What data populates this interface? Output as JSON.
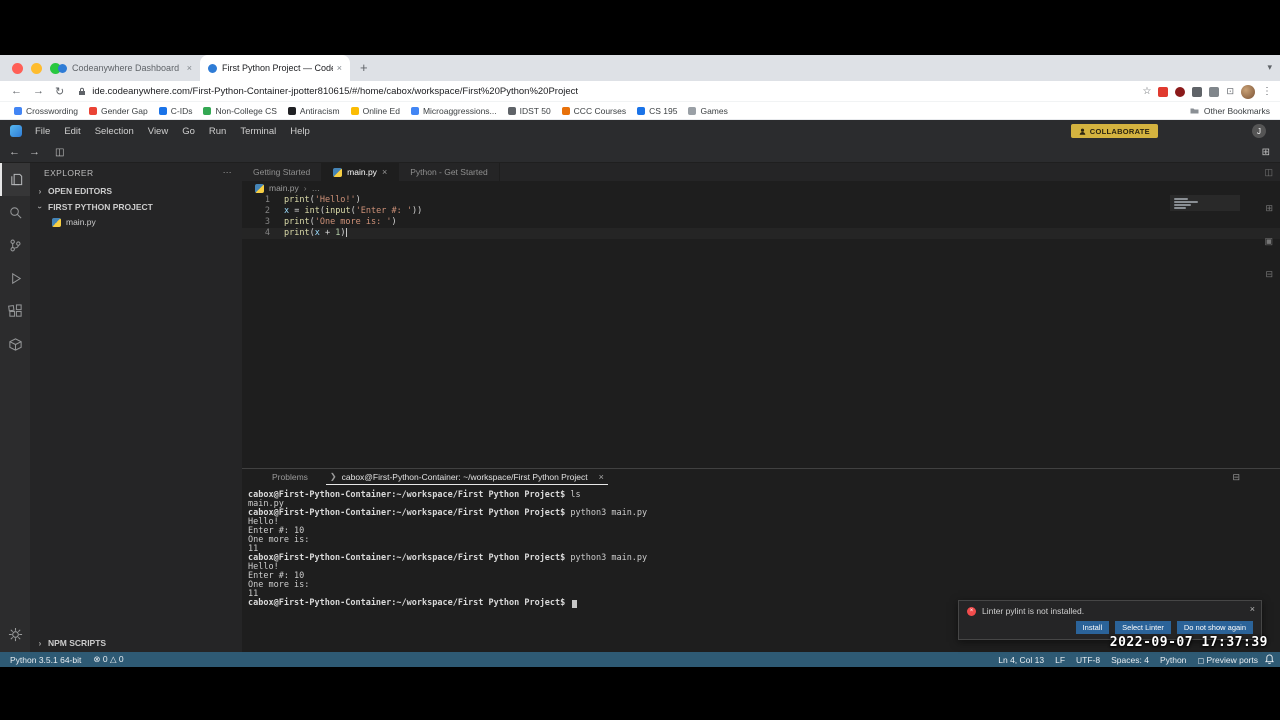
{
  "colors": {
    "statusbar_bg": "#2e5a74",
    "collaborate_bg": "#d4b33f",
    "accent_blue": "#2b6399",
    "error_red": "#f14c4c"
  },
  "browser": {
    "tabs": [
      {
        "title": "Codeanywhere Dashboard",
        "active": false
      },
      {
        "title": "First Python Project — Codea",
        "active": true
      }
    ],
    "url": "ide.codeanywhere.com/First-Python-Container-jpotter810615/#/home/cabox/workspace/First%20Python%20Project",
    "bookmarks": [
      "Crosswording",
      "Gender Gap",
      "C-IDs",
      "Non-College CS",
      "Antiracism",
      "Online Ed",
      "Microaggressions...",
      "IDST 50",
      "CCC Courses",
      "CS 195",
      "Games"
    ],
    "bookmark_colors": [
      "#4285f4",
      "#ea4335",
      "#1a73e8",
      "#34a853",
      "#202124",
      "#fbbc04",
      "#4285f4",
      "#5f6368",
      "#e8710a",
      "#1a73e8",
      "#9aa0a6"
    ],
    "other_bookmarks": "Other Bookmarks"
  },
  "menubar": {
    "items": [
      "File",
      "Edit",
      "Selection",
      "View",
      "Go",
      "Run",
      "Terminal",
      "Help"
    ],
    "collaborate_label": "COLLABORATE",
    "avatar_initial": "J"
  },
  "activitybar": {
    "items": [
      "explorer",
      "search",
      "source-control",
      "run-debug",
      "extensions",
      "workspace"
    ]
  },
  "explorer": {
    "title": "EXPLORER",
    "sections": {
      "open_editors": "OPEN EDITORS",
      "project": "FIRST PYTHON PROJECT",
      "npm_scripts": "NPM SCRIPTS"
    },
    "files": [
      {
        "name": "main.py"
      }
    ]
  },
  "editor": {
    "tabs": [
      {
        "label": "Getting Started"
      },
      {
        "label": "main.py",
        "icon": "python",
        "close": true,
        "active": true
      },
      {
        "label": "Python - Get Started"
      }
    ],
    "breadcrumb": {
      "file": "main.py",
      "more": "…"
    },
    "code": [
      {
        "num": "1",
        "tokens": [
          [
            "print",
            "fn"
          ],
          [
            "(",
            "pl"
          ],
          [
            "'Hello!'",
            "str"
          ],
          [
            ")",
            "pl"
          ]
        ]
      },
      {
        "num": "2",
        "tokens": [
          [
            "x",
            "var"
          ],
          [
            " = ",
            "op"
          ],
          [
            "int",
            "fn"
          ],
          [
            "(",
            "pl"
          ],
          [
            "input",
            "fn"
          ],
          [
            "(",
            "pl"
          ],
          [
            "'Enter #: '",
            "str"
          ],
          [
            "))",
            "pl"
          ]
        ]
      },
      {
        "num": "3",
        "tokens": [
          [
            "print",
            "fn"
          ],
          [
            "(",
            "pl"
          ],
          [
            "'One more is: '",
            "str"
          ],
          [
            ")",
            "pl"
          ]
        ]
      },
      {
        "num": "4",
        "cursor": true,
        "tokens": [
          [
            "print",
            "fn"
          ],
          [
            "(",
            "pl"
          ],
          [
            "x",
            "var"
          ],
          [
            " + ",
            "op"
          ],
          [
            "1",
            "num"
          ],
          [
            ")",
            "pl"
          ]
        ]
      }
    ]
  },
  "panel": {
    "tabs": {
      "problems": "Problems",
      "terminal": "cabox@First-Python-Container: ~/workspace/First Python Project"
    },
    "terminal": {
      "prompt": "cabox@First-Python-Container:~/workspace/First Python Project$",
      "lines": [
        {
          "cmd": "ls"
        },
        {
          "out": "main.py"
        },
        {
          "cmd": "python3 main.py"
        },
        {
          "out": "Hello!"
        },
        {
          "out": "Enter #: 10"
        },
        {
          "out": "One more is: "
        },
        {
          "out": "11"
        },
        {
          "cmd": "python3 main.py"
        },
        {
          "out": "Hello!"
        },
        {
          "out": "Enter #: 10"
        },
        {
          "out": "One more is: "
        },
        {
          "out": "11"
        },
        {
          "cmd": "",
          "cursor": true
        }
      ]
    }
  },
  "statusbar": {
    "interpreter": "Python 3.5.1 64-bit",
    "errors": "0",
    "warnings": "0",
    "right": [
      {
        "label": "Ln 4, Col 13",
        "name": "cursor-position"
      },
      {
        "label": "LF",
        "name": "eol-sequence"
      },
      {
        "label": "UTF-8",
        "name": "encoding"
      },
      {
        "label": "Spaces: 4",
        "name": "indentation"
      },
      {
        "label": "Python",
        "name": "language-mode"
      },
      {
        "label": "Preview ports",
        "name": "preview-ports",
        "icon": "ports"
      }
    ]
  },
  "notification": {
    "message": "Linter pylint is not installed.",
    "buttons": [
      "Install",
      "Select Linter",
      "Do not show again"
    ]
  },
  "overlay": {
    "timestamp": "2022-09-07 17:37:39"
  }
}
